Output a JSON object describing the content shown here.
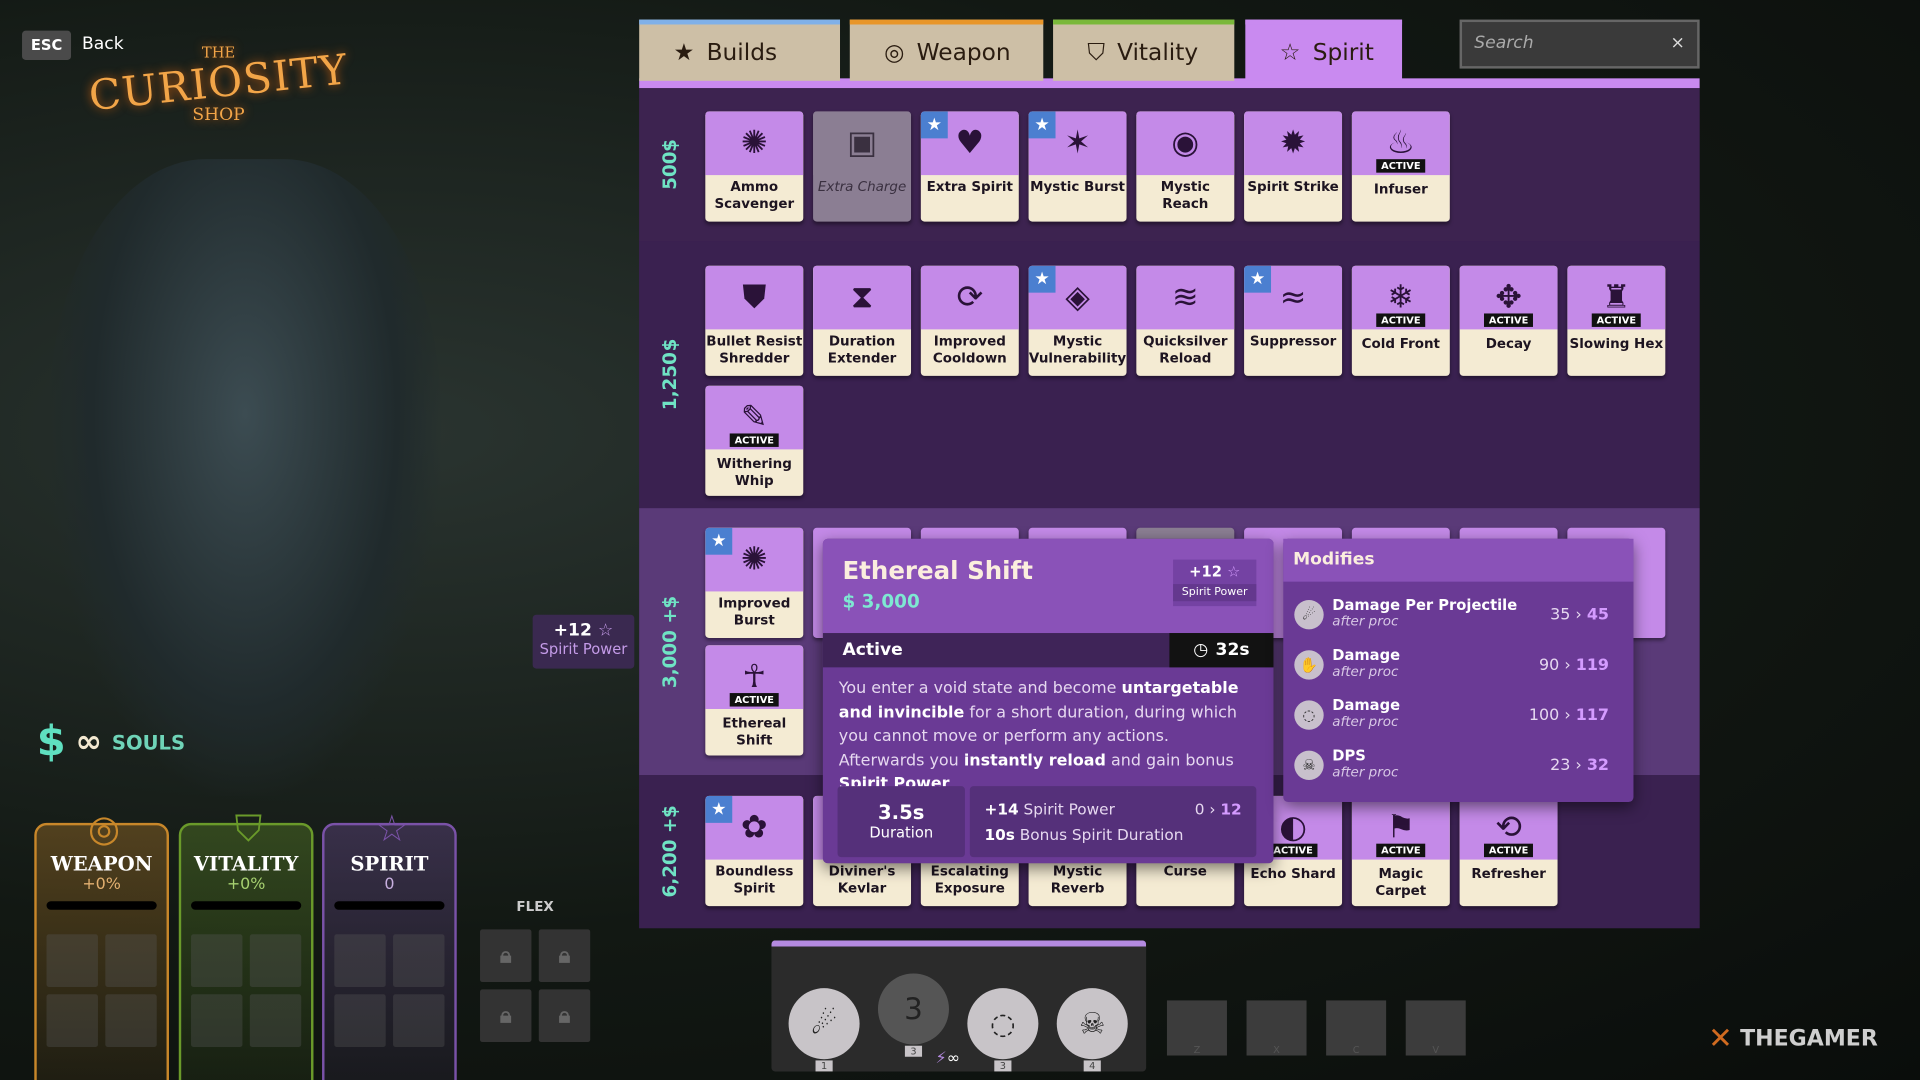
{
  "header": {
    "esc_key": "ESC",
    "back_label": "Back",
    "logo": {
      "the": "THE",
      "curiosity": "CURIOSITY",
      "shop": "SHOP"
    }
  },
  "tabs": [
    {
      "label": "Builds",
      "icon": "star-icon",
      "accent": "#7fb0e8"
    },
    {
      "label": "Weapon",
      "icon": "weapon-target-icon",
      "accent": "#e8962a"
    },
    {
      "label": "Vitality",
      "icon": "vitality-shield-icon",
      "accent": "#7ab83a"
    },
    {
      "label": "Spirit",
      "icon": "spirit-star-icon",
      "accent": "#c98af0",
      "active": true
    }
  ],
  "search": {
    "placeholder": "Search",
    "clear": "×"
  },
  "tiers": [
    {
      "cost": "500",
      "items": [
        {
          "name": "Ammo Scavenger",
          "icon": "✺"
        },
        {
          "name": "Extra Charge",
          "icon": "▣",
          "disabled": true
        },
        {
          "name": "Extra Spirit",
          "icon": "♥",
          "starred": true
        },
        {
          "name": "Mystic Burst",
          "icon": "✶",
          "starred": true
        },
        {
          "name": "Mystic Reach",
          "icon": "◉"
        },
        {
          "name": "Spirit Strike",
          "icon": "✹"
        },
        {
          "name": "Infuser",
          "icon": "♨",
          "active": true
        }
      ]
    },
    {
      "cost": "1,250",
      "items": [
        {
          "name": "Bullet Resist Shredder",
          "icon": "⛊"
        },
        {
          "name": "Duration Extender",
          "icon": "⧗"
        },
        {
          "name": "Improved Cooldown",
          "icon": "⟳"
        },
        {
          "name": "Mystic Vulnerability",
          "icon": "◈",
          "starred": true
        },
        {
          "name": "Quicksilver Reload",
          "icon": "≋"
        },
        {
          "name": "Suppressor",
          "icon": "≈",
          "starred": true
        },
        {
          "name": "Cold Front",
          "icon": "❄",
          "active": true
        },
        {
          "name": "Decay",
          "icon": "✥",
          "active": true
        },
        {
          "name": "Slowing Hex",
          "icon": "♜",
          "active": true
        },
        {
          "name": "Withering Whip",
          "icon": "✎",
          "active": true
        }
      ]
    },
    {
      "cost": "3,000 +",
      "items": [
        {
          "name": "Improved Burst",
          "icon": "✺",
          "starred": true
        },
        {
          "name": "Ethereal Shift",
          "icon": "☥",
          "active": true
        }
      ]
    },
    {
      "cost": "6,200 +",
      "items": [
        {
          "name": "Boundless Spirit",
          "icon": "✿",
          "starred": true
        },
        {
          "name": "Diviner's Kevlar",
          "icon": "⛨"
        },
        {
          "name": "Escalating Exposure",
          "icon": "⬆"
        },
        {
          "name": "Mystic Reverb",
          "icon": "◎"
        },
        {
          "name": "Curse",
          "icon": "☠"
        },
        {
          "name": "Echo Shard",
          "icon": "◐",
          "active": true
        },
        {
          "name": "Magic Carpet",
          "icon": "⚑",
          "active": true
        },
        {
          "name": "Refresher",
          "icon": "⟲",
          "active": true
        }
      ]
    }
  ],
  "active_badge": "ACTIVE",
  "tooltip": {
    "title": "Ethereal Shift",
    "cost": "3,000",
    "bonus_value": "+12",
    "bonus_label": "Spirit Power",
    "section": "Active",
    "cooldown": "32s",
    "desc": [
      [
        "You enter a void state and become ",
        false
      ],
      [
        "untargetable and invincible",
        true
      ],
      [
        " for a short duration, during which you cannot move or perform any actions. Afterwards you ",
        false
      ],
      [
        "instantly reload",
        true
      ],
      [
        " and gain bonus ",
        false
      ],
      [
        "Spirit Power",
        true
      ],
      [
        ".",
        false
      ]
    ],
    "duration_value": "3.5s",
    "duration_label": "Duration",
    "bonus1_value": "+14",
    "bonus1_label": "Spirit Power",
    "bonus1_from": "0",
    "bonus1_to": "12",
    "bonus2_value": "10s",
    "bonus2_label": "Bonus Spirit Duration"
  },
  "modifies": {
    "title": "Modifies",
    "rows": [
      {
        "name": "Damage Per Projectile",
        "sub": "after proc",
        "from": "35",
        "to": "45",
        "icon": "fireball-icon"
      },
      {
        "name": "Damage",
        "sub": "after proc",
        "from": "90",
        "to": "119",
        "icon": "claw-icon"
      },
      {
        "name": "Damage",
        "sub": "after proc",
        "from": "100",
        "to": "117",
        "icon": "vortex-icon"
      },
      {
        "name": "DPS",
        "sub": "after proc",
        "from": "23",
        "to": "32",
        "icon": "skull-icon"
      }
    ]
  },
  "spirit_power_badge": {
    "value": "+12",
    "label": "Spirit Power"
  },
  "souls": {
    "label": "SOULS"
  },
  "stats": [
    {
      "name": "WEAPON",
      "value": "+0%",
      "color": "#c8872a",
      "text": "#e2b070"
    },
    {
      "name": "VITALITY",
      "value": "+0%",
      "color": "#6a9a2a",
      "text": "#a6d070"
    },
    {
      "name": "SPIRIT",
      "value": "0",
      "color": "#7a52a8",
      "text": "#c8b0e0"
    }
  ],
  "flex_label": "FLEX",
  "abilities": [
    {
      "key": "1",
      "icon": "fireball-icon"
    },
    {
      "key": "3",
      "icon": "claw-icon",
      "level": "3"
    },
    {
      "key": "3",
      "icon": "vortex-icon"
    },
    {
      "key": "4",
      "icon": "skull-icon"
    }
  ],
  "item_keys": [
    "Z",
    "X",
    "C",
    "V"
  ],
  "watermark": "THEGAMER"
}
